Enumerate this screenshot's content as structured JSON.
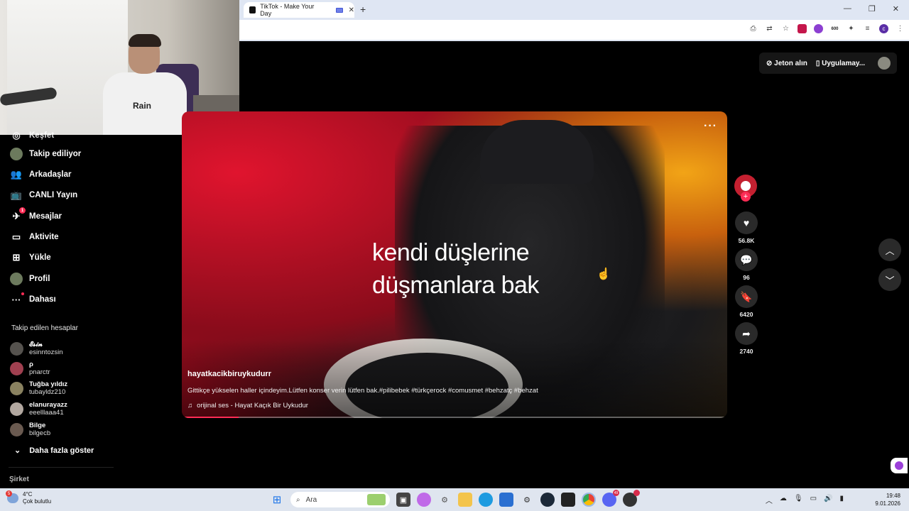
{
  "browser": {
    "tab_title": "TikTok - Make Your Day",
    "ext_badge_600": "600",
    "profile_initial": "c"
  },
  "webcam": {
    "shirt_text": "Rain"
  },
  "sidebar": {
    "items": [
      {
        "label": "Keşfet",
        "icon": "compass-icon"
      },
      {
        "label": "Takip ediliyor",
        "icon": "following-avatar-icon"
      },
      {
        "label": "Arkadaşlar",
        "icon": "friends-icon"
      },
      {
        "label": "CANLI Yayın",
        "icon": "live-tv-icon"
      },
      {
        "label": "Mesajlar",
        "icon": "messages-icon",
        "badge": "1"
      },
      {
        "label": "Aktivite",
        "icon": "activity-icon"
      },
      {
        "label": "Yükle",
        "icon": "upload-icon"
      },
      {
        "label": "Profil",
        "icon": "profile-avatar-icon"
      },
      {
        "label": "Dahası",
        "icon": "more-dots-icon"
      }
    ],
    "following_heading": "Takip edilen hesaplar",
    "following": [
      {
        "name": "𝓔𝓼𝓲𝓷",
        "user": "esinntozsin"
      },
      {
        "name": "ρ",
        "user": "pnarctr"
      },
      {
        "name": "Tuğba yıldız",
        "user": "tubayldz210"
      },
      {
        "name": "elanurayazz",
        "user": "eeelllaaa41"
      },
      {
        "name": "Bilge",
        "user": "bilgecb"
      }
    ],
    "show_more": "Daha fazla göster",
    "company": "Şirket"
  },
  "header": {
    "coins": "Jeton alın",
    "app": "Uygulamay..."
  },
  "video": {
    "lyric_line1": "kendi düşlerine",
    "lyric_line2": "düşmanlara bak",
    "author": "hayatkacikbiruykudurr",
    "description": "Gittikçe yükselen haller içindeyim.Lütfen konser verin lütfen bak.#pilibebek #türkçerock #comusmet #behzatç #behzat",
    "sound": "orijinal ses - Hayat Kaçık Bir Uykudur",
    "progress": 0.1
  },
  "actions": {
    "likes": "56.8K",
    "comments": "96",
    "saves": "6420",
    "shares": "2740"
  },
  "taskbar": {
    "temp": "4°C",
    "weather": "Çok bulutlu",
    "weather_badge": "5",
    "search_placeholder": "Ara",
    "time": "19:48",
    "date": "9.01.2026",
    "discord_badge": "49"
  }
}
